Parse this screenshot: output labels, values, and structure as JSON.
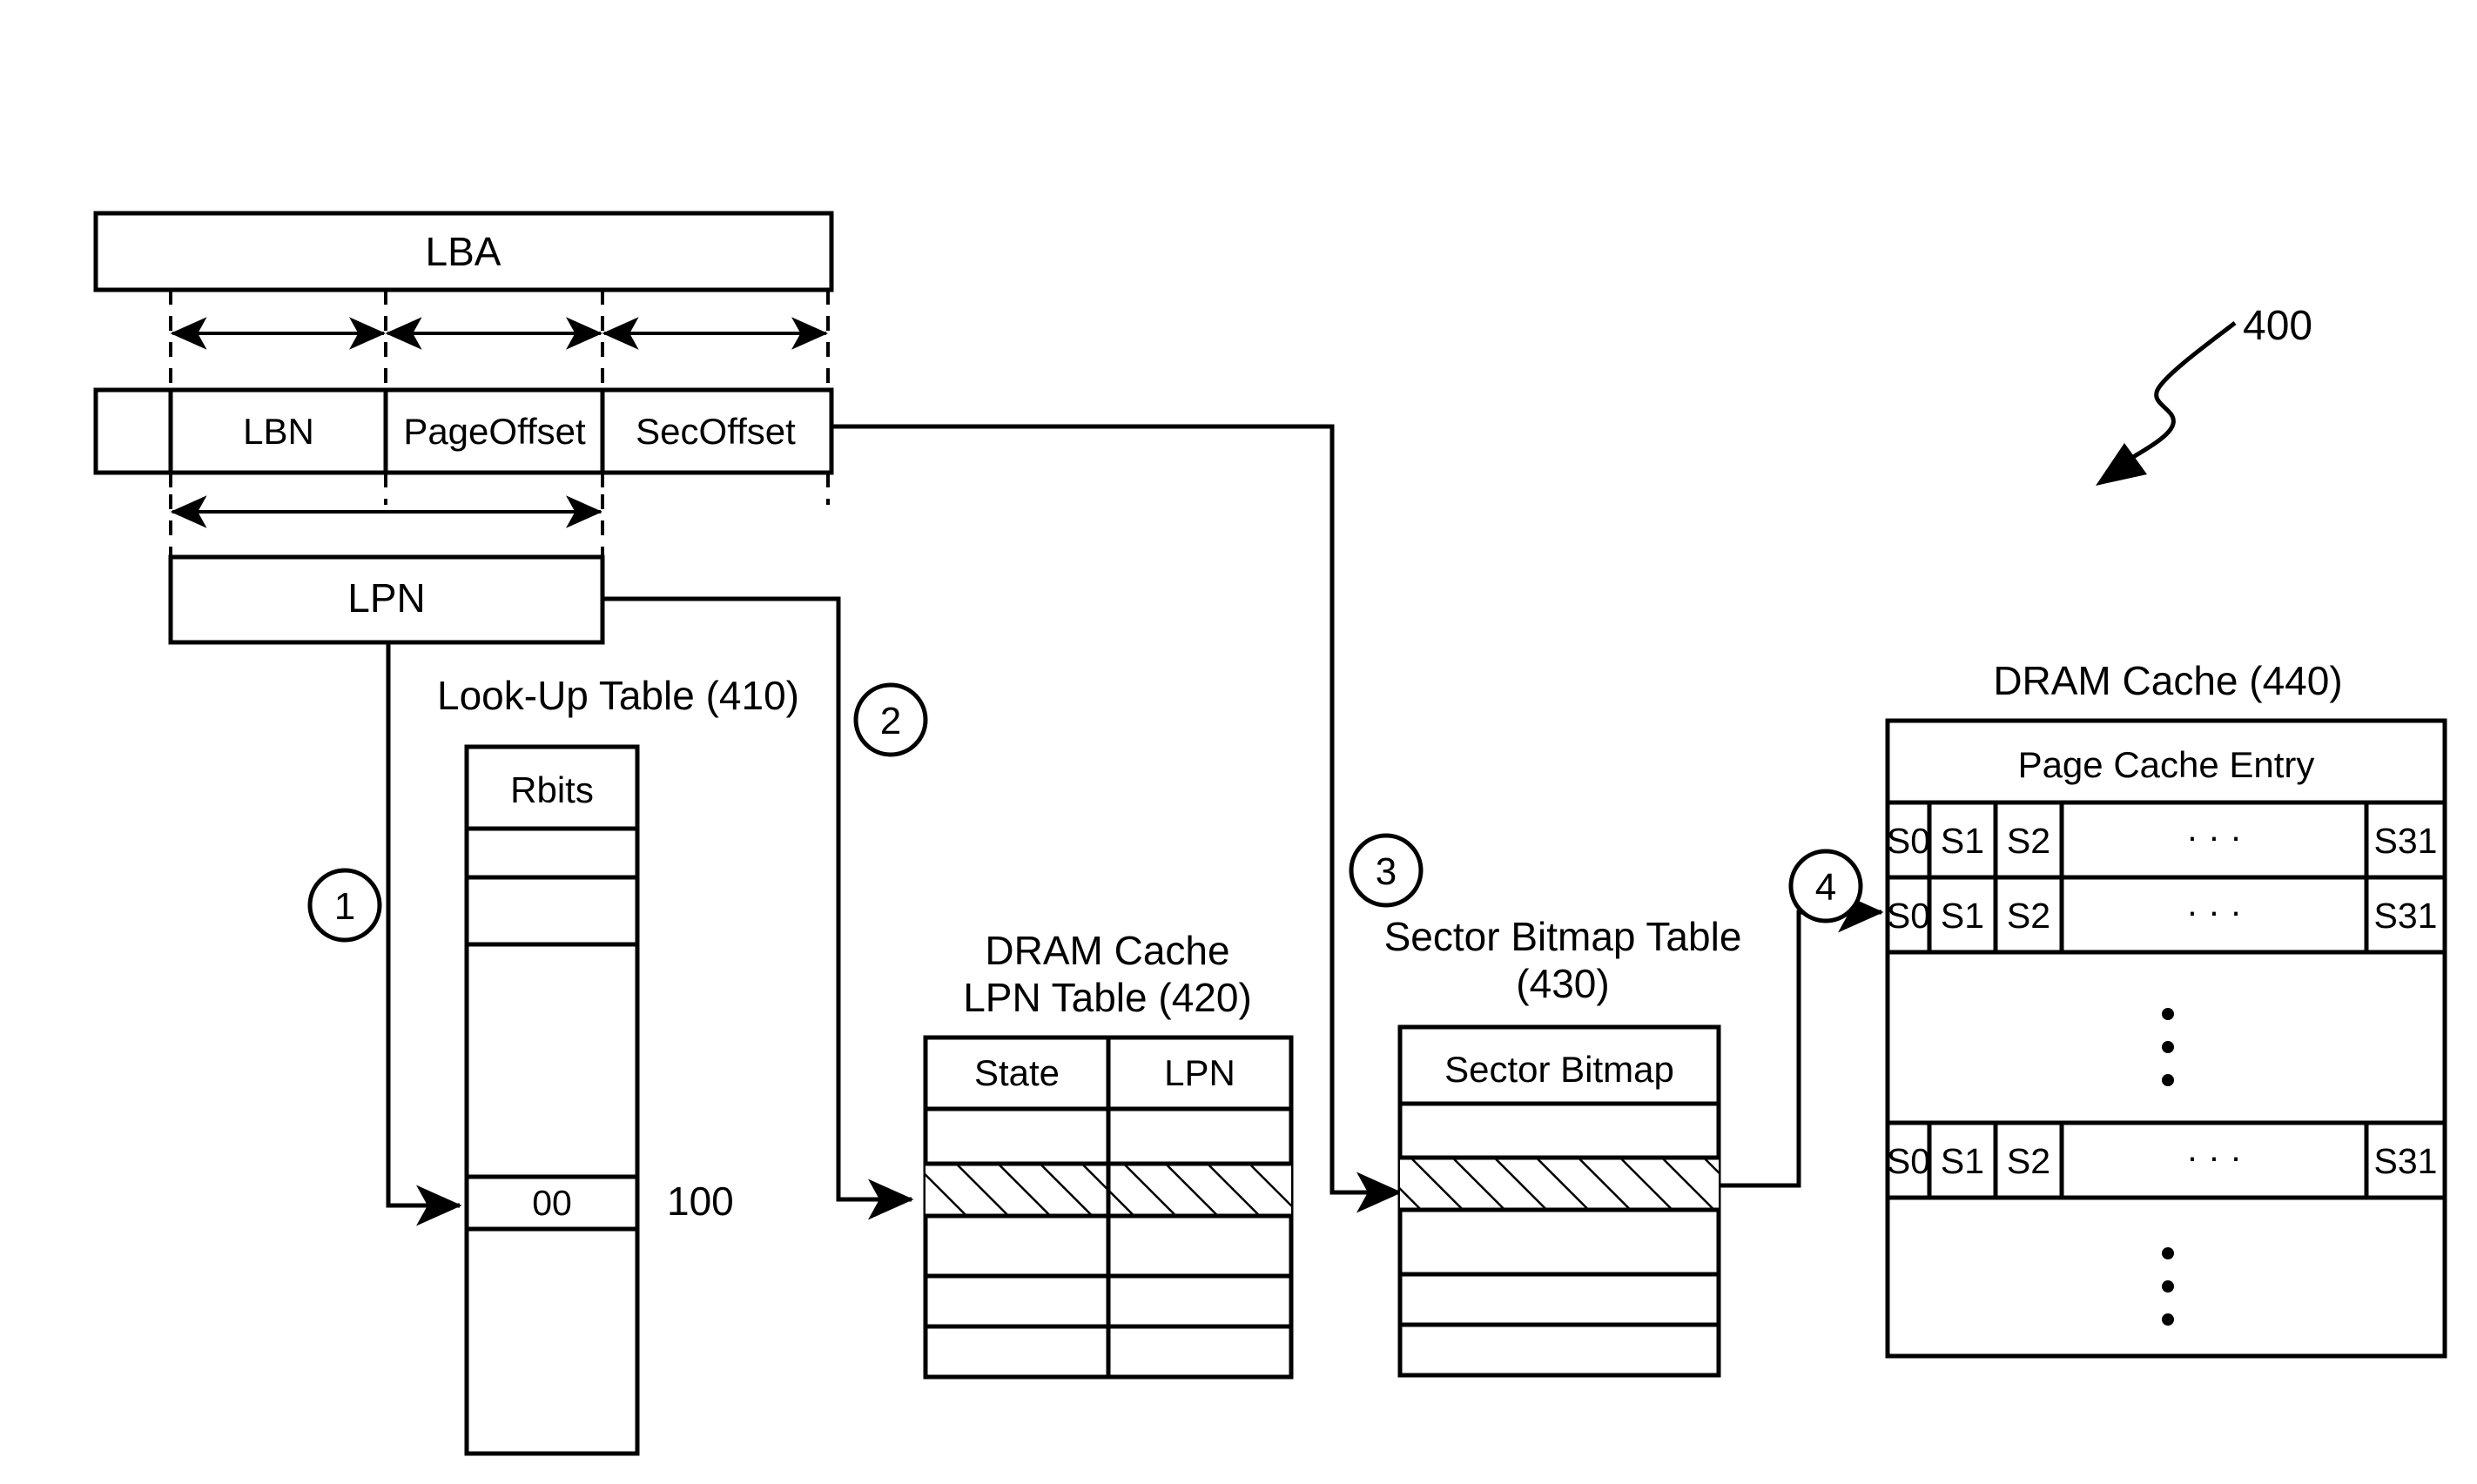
{
  "figure": {
    "reference_number": "400",
    "address_row": {
      "lba_label": "LBA",
      "fields": [
        "LBN",
        "PageOffset",
        "SecOffset"
      ],
      "lpn_label": "LPN"
    },
    "steps": [
      {
        "number": "1"
      },
      {
        "number": "2"
      },
      {
        "number": "3"
      },
      {
        "number": "4"
      }
    ],
    "lookup_table": {
      "caption": "Look-Up Table (410)",
      "column_header": "Rbits",
      "highlighted_value": "00",
      "side_annotation": "100"
    },
    "lpn_table": {
      "caption_line1": "DRAM Cache",
      "caption_line2": "LPN Table (420)",
      "columns": [
        "State",
        "LPN"
      ]
    },
    "sector_bitmap_table": {
      "caption_line1": "Sector Bitmap Table",
      "caption_line2": "(430)",
      "column_header": "Sector Bitmap"
    },
    "dram_cache": {
      "caption": "DRAM Cache (440)",
      "header": "Page Cache Entry",
      "sector_cells": [
        "S0",
        "S1",
        "S2",
        "·  ·  ·",
        "S31"
      ],
      "row_count_visible": 3,
      "ellipsis": "⋮"
    }
  }
}
